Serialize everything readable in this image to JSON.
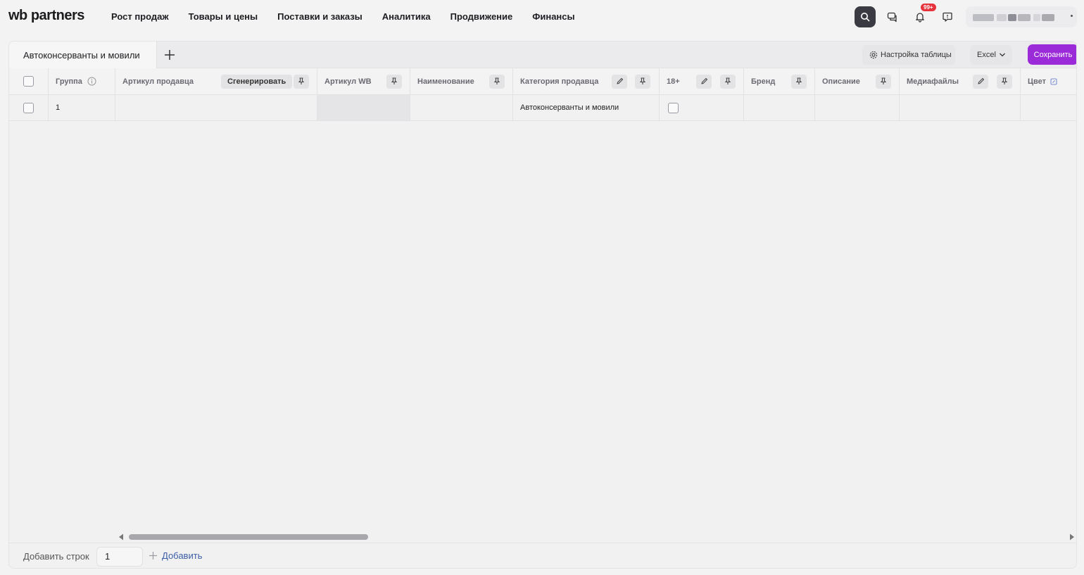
{
  "logo": {
    "wb": "wb",
    "rest": " partners"
  },
  "nav": [
    {
      "label": "Рост продаж"
    },
    {
      "label": "Товары и цены"
    },
    {
      "label": "Поставки и заказы"
    },
    {
      "label": "Аналитика"
    },
    {
      "label": "Продвижение"
    },
    {
      "label": "Финансы"
    }
  ],
  "header_icons": {
    "search": "search-icon",
    "chat": "chat-icon",
    "bell": "bell-icon",
    "feedback": "feedback-icon",
    "notifications_badge": "99+"
  },
  "colors": {
    "accent": "#9b2ad8",
    "link": "#3b5ea8",
    "badge": "#e5323b",
    "search_bg": "#3a3a42"
  },
  "tabs": [
    {
      "label": "Автоконсерванты и мовили"
    }
  ],
  "toolbar": {
    "settings_label": "Настройка таблицы",
    "excel_label": "Excel",
    "save_label": "Сохранить"
  },
  "table": {
    "headers": {
      "group": "Группа",
      "seller_article": "Артикул продавца",
      "generate": "Сгенерировать",
      "wb_article": "Артикул WB",
      "name": "Наименование",
      "seller_category": "Категория продавца",
      "adult": "18+",
      "brand": "Бренд",
      "description": "Описание",
      "media": "Медиафайлы",
      "color": "Цвет"
    },
    "rows": [
      {
        "group": "1",
        "seller_article": "",
        "wb_article": "",
        "name": "",
        "seller_category": "Автоконсерванты и мовили",
        "adult": false,
        "brand": "",
        "description": "",
        "media": "",
        "color": ""
      }
    ]
  },
  "footer": {
    "add_rows_label": "Добавить строк",
    "rows_value": "1",
    "add_label": "Добавить"
  }
}
